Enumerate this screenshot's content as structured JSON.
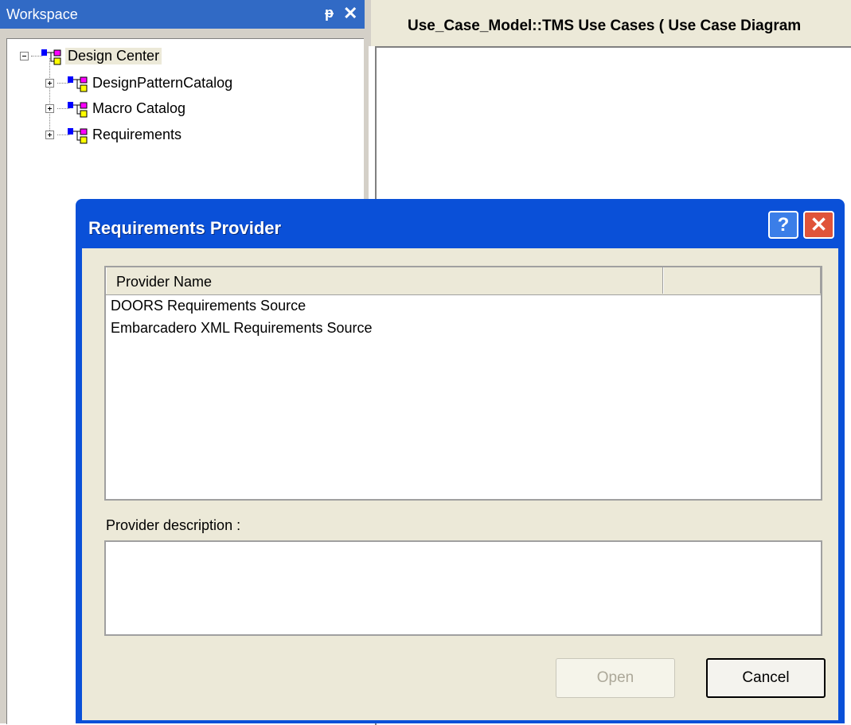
{
  "workspace": {
    "title": "Workspace",
    "pin_icon": "pin-icon",
    "close_icon": "close-icon",
    "pin_glyph": "ᵽ",
    "close_glyph": "✕",
    "tree": {
      "root": {
        "label": "Design Center",
        "expander": "minus"
      },
      "children": [
        {
          "label": "DesignPatternCatalog",
          "expander": "plus"
        },
        {
          "label": "Macro Catalog",
          "expander": "plus"
        },
        {
          "label": "Requirements",
          "expander": "plus"
        }
      ]
    }
  },
  "diagram": {
    "tab_title": "Use_Case_Model::TMS Use Cases ( Use Case Diagram"
  },
  "dialog": {
    "title": "Requirements Provider",
    "help_glyph": "?",
    "close_glyph": "✕",
    "list": {
      "columns": [
        "Provider Name",
        ""
      ],
      "rows": [
        "DOORS Requirements Source",
        "Embarcadero XML Requirements Source"
      ]
    },
    "description_label": "Provider description :",
    "description_value": "",
    "open_label": "Open",
    "cancel_label": "Cancel"
  },
  "colors": {
    "title_blue": "#0a50d8",
    "workspace_title": "#316ac5",
    "dialog_face": "#ece9d8",
    "close_red": "#e0543a"
  }
}
